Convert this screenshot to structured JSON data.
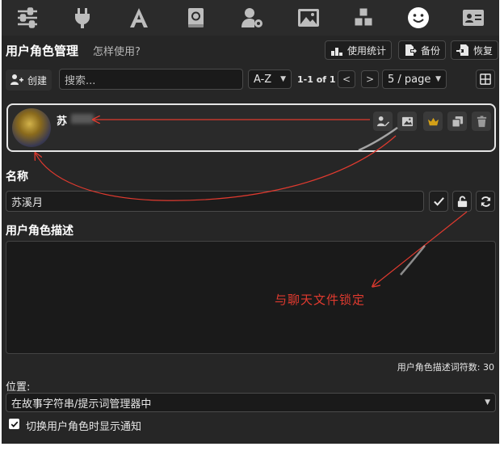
{
  "nav": {
    "icons": [
      "sliders-icon",
      "plug-icon",
      "font-icon",
      "book-atlas-icon",
      "user-gear-icon",
      "image-icon",
      "cubes-icon",
      "face-smile-icon",
      "id-card-icon"
    ]
  },
  "header": {
    "title": "用户角色管理",
    "help": "怎样使用?",
    "usage_stats": "使用统计",
    "backup": "备份",
    "restore": "恢复"
  },
  "toolbar": {
    "create": "创建",
    "search_placeholder": "搜索...",
    "sort": "A-Z",
    "page_info": "1-1 of 1",
    "prev": "<",
    "next": ">",
    "page_size": "5 / page"
  },
  "persona": {
    "name": "苏"
  },
  "name_section": {
    "label": "名称",
    "value": "苏溪月"
  },
  "description": {
    "label": "用户角色描述",
    "annotation": "与聊天文件锁定",
    "token_count": "用户角色描述词符数: 30"
  },
  "position": {
    "label": "位置:",
    "value": "在故事字符串/提示词管理器中"
  },
  "notify": {
    "label": "切换用户角色时显示通知",
    "checked": true
  },
  "colors": {
    "accent_red": "#e03a2f",
    "crown_gold": "#d4a017",
    "background": "#262626"
  }
}
